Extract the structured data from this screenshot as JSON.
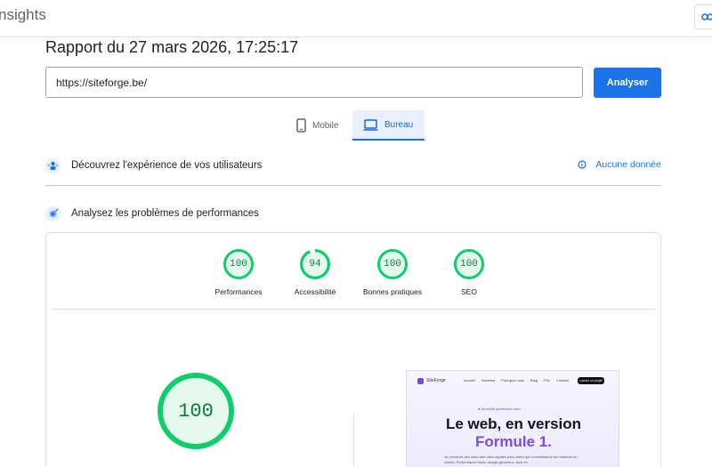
{
  "app": {
    "title": "nsights"
  },
  "header": {
    "link_icon": "link-icon"
  },
  "report": {
    "title": "Rapport du 27 mars 2026, 17:25:17"
  },
  "search": {
    "value": "https://siteforge.be/",
    "button_label": "Analyser"
  },
  "device_tabs": [
    {
      "label": "Mobile",
      "icon": "smartphone-icon",
      "selected": false
    },
    {
      "label": "Bureau",
      "icon": "desktop-icon",
      "selected": true
    }
  ],
  "sections": {
    "ux": {
      "title": "Découvrez l'expérience de vos utilisateurs",
      "status": "Aucune donnée",
      "icon": "users-icon"
    },
    "perf": {
      "title": "Analysez les problèmes de performances",
      "icon": "diagnostics-icon"
    }
  },
  "scores": [
    {
      "value": "100",
      "label": "Performances",
      "fraction": 1.0
    },
    {
      "value": "94",
      "label": "Accessibilité",
      "fraction": 0.94
    },
    {
      "value": "100",
      "label": "Bonnes pratiques",
      "fraction": 1.0
    },
    {
      "value": "100",
      "label": "SEO",
      "fraction": 1.0
    }
  ],
  "main_score": {
    "value": "100",
    "fraction": 1.0
  },
  "colors": {
    "accent": "#1a73e8",
    "pass": "#0cce6b",
    "pass_text": "#0a7d3c",
    "pass_bg": "#e6f9ee"
  },
  "screenshot": {
    "logo": "SiteForge",
    "nav_links": [
      "Accueil",
      "Services",
      "Pourquoi nous",
      "Blog",
      "Prix",
      "Contact"
    ],
    "cta": "Lancer un projet",
    "badge": "● Nouvelle génération web",
    "headline_1": "Le web, en version",
    "headline_2": "Formule 1.",
    "paragraph": "Je construis des sites web ultra-rapides avec Astro qui convertissent vos visiteurs en clients. Performance brute, design généreux, tech en"
  }
}
